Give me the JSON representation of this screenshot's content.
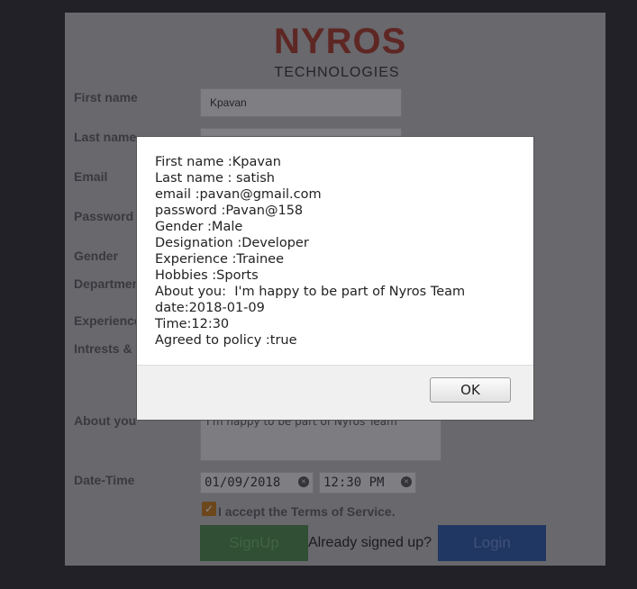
{
  "logo": {
    "main": "NYROS",
    "sub": "TECHNOLOGIES"
  },
  "form": {
    "labels": {
      "first_name": "First name",
      "last_name": "Last name",
      "email": "Email",
      "password": "Password",
      "gender": "Gender",
      "department": "Department",
      "experience": "Experience",
      "interests": "Intrests & Hobbies",
      "about": "About you",
      "datetime": "Date-Time"
    },
    "first_name_value": "Kpavan",
    "about_value": "I'm happy to be part of Nyros Team",
    "date_value": "01/09/2018",
    "time_value": "12:30 PM",
    "terms": "I accept the Terms of Service.",
    "signup": "SignUp",
    "already": "Already signed up?",
    "login": "Login"
  },
  "dialog": {
    "lines": [
      "First name :Kpavan",
      "Last name : satish",
      "email :pavan@gmail.com",
      "password :Pavan@158",
      "Gender :Male",
      "Designation :Developer",
      "Experience :Trainee",
      "Hobbies :Sports",
      "About you:  I'm happy to be part of Nyros Team",
      "date:2018-01-09",
      "Time:12:30",
      "Agreed to policy :true"
    ],
    "ok": "OK"
  }
}
